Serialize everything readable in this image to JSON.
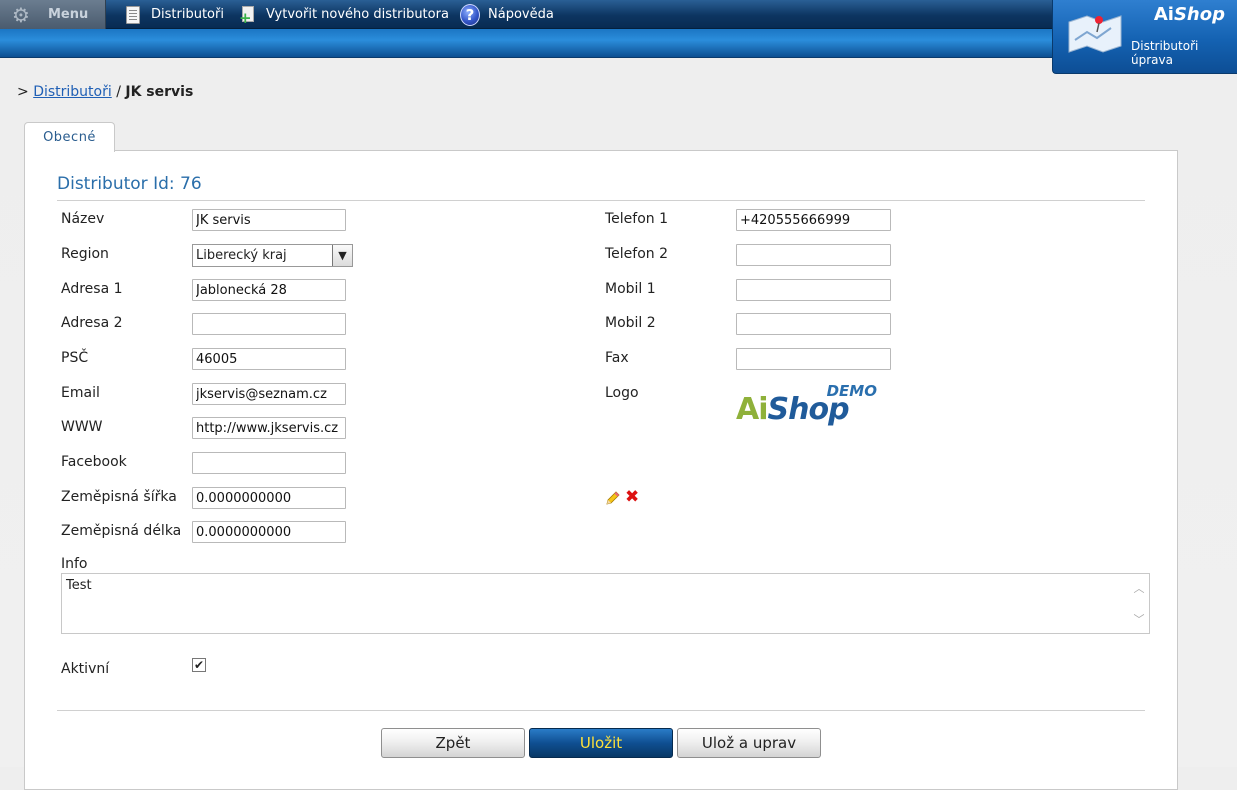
{
  "topbar": {
    "menu_label": "Menu",
    "nav": [
      {
        "label": "Distributoři",
        "icon": "document-icon"
      },
      {
        "label": "Vytvořit nového distributora",
        "icon": "new-document-icon"
      },
      {
        "label": "Nápověda",
        "icon": "help-icon"
      }
    ]
  },
  "badge": {
    "brand_ai": "Ai",
    "brand_shop": "Shop",
    "line1": "Distributoři",
    "line2": "úprava"
  },
  "breadcrumb": {
    "prefix": ">",
    "link": "Distributoři",
    "separator": "/",
    "current": "JK servis"
  },
  "tabs": [
    {
      "label": "Obecné",
      "active": true
    }
  ],
  "form": {
    "title": "Distributor Id: 76",
    "left": [
      {
        "label": "Název",
        "value": "JK servis",
        "type": "text"
      },
      {
        "label": "Region",
        "value": "Liberecký kraj",
        "type": "select"
      },
      {
        "label": "Adresa 1",
        "value": "Jablonecká 28",
        "type": "text"
      },
      {
        "label": "Adresa 2",
        "value": "",
        "type": "text"
      },
      {
        "label": "PSČ",
        "value": "46005",
        "type": "text"
      },
      {
        "label": "Email",
        "value": "jkservis@seznam.cz",
        "type": "text"
      },
      {
        "label": "WWW",
        "value": "http://www.jkservis.cz",
        "type": "text"
      },
      {
        "label": "Facebook",
        "value": "",
        "type": "text"
      },
      {
        "label": "Zeměpisná šířka",
        "value": "0.0000000000",
        "type": "text"
      },
      {
        "label": "Zeměpisná délka",
        "value": "0.0000000000",
        "type": "text"
      }
    ],
    "right": [
      {
        "label": "Telefon 1",
        "value": "+420555666999"
      },
      {
        "label": "Telefon 2",
        "value": ""
      },
      {
        "label": "Mobil 1",
        "value": ""
      },
      {
        "label": "Mobil 2",
        "value": ""
      },
      {
        "label": "Fax",
        "value": ""
      }
    ],
    "logo_label": "Logo",
    "logo_demo": "DEMO",
    "logo_ai": "Ai",
    "logo_shop": "Shop",
    "info_label": "Info",
    "info_value": "Test",
    "active_label": "Aktivní",
    "active_checked": true
  },
  "buttons": {
    "back": "Zpět",
    "save": "Uložit",
    "save_edit": "Ulož a uprav"
  }
}
